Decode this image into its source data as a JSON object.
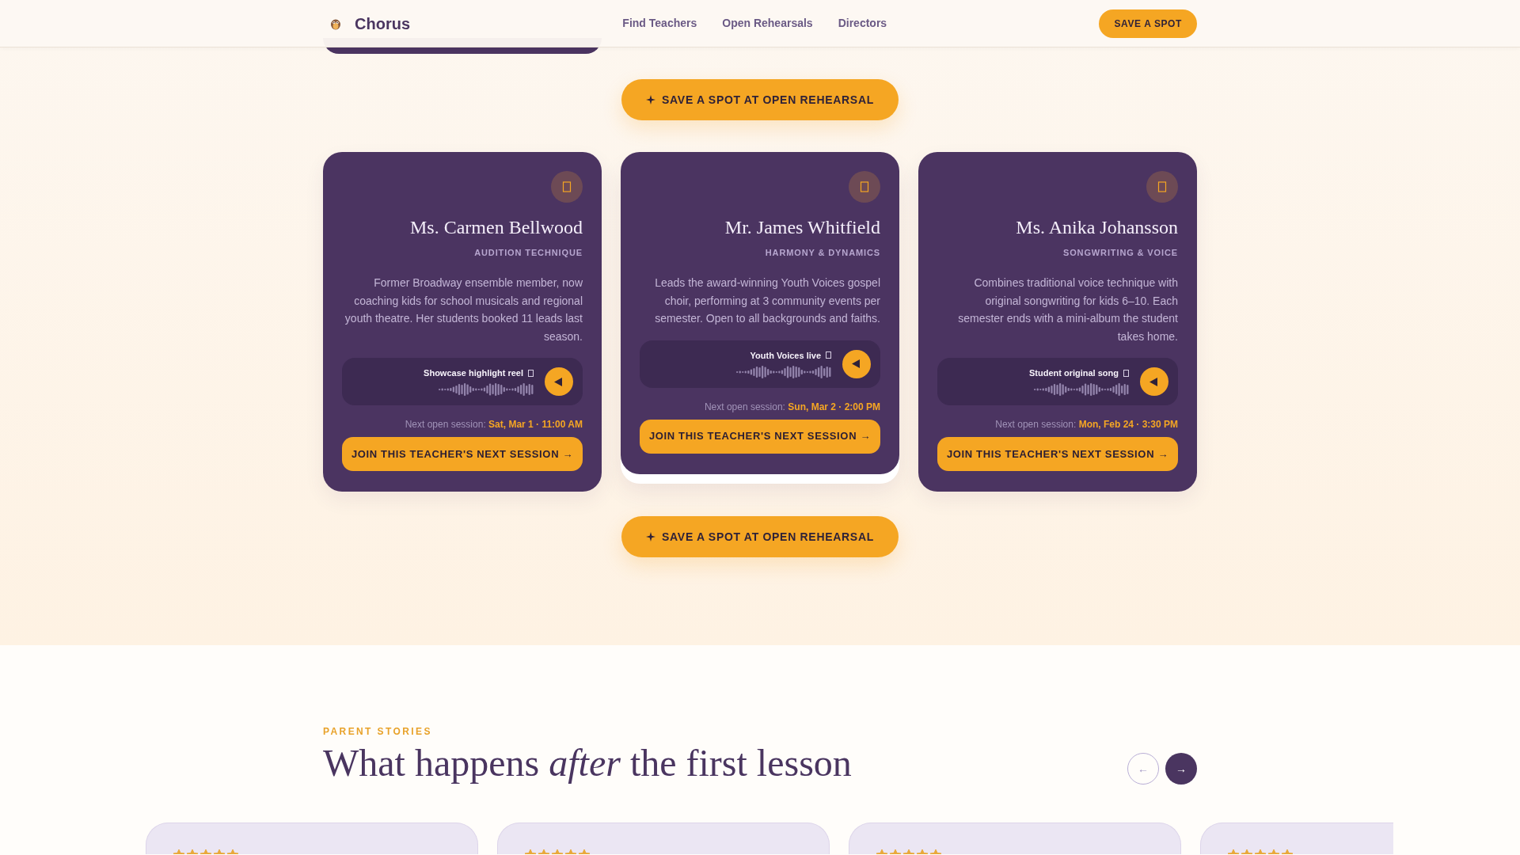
{
  "header": {
    "brand": "Chorus",
    "nav": [
      {
        "label": "Find Teachers"
      },
      {
        "label": "Open Rehearsals"
      },
      {
        "label": "Directors"
      }
    ],
    "cta": "SAVE A SPOT"
  },
  "rehearsal_cta_top": "SAVE A SPOT AT OPEN REHEARSAL",
  "teachers": [
    {
      "name": "Ms. Carmen Bellwood",
      "specialty": "AUDITION TECHNIQUE",
      "bio": "Former Broadway ensemble member, now coaching kids for school musicals and regional youth theatre. Her students booked 11 leads last season.",
      "clip": "Showcase highlight reel",
      "session": "Next open session: **Sat, Mar 1 · 11:00 AM**",
      "join": "JOIN THIS TEACHER'S NEXT SESSION →",
      "raised": false
    },
    {
      "name": "Mr. James Whitfield",
      "specialty": "HARMONY & DYNAMICS",
      "bio": "Leads the award-winning Youth Voices gospel choir, performing at 3 community events per semester. Open to all backgrounds and faiths.",
      "clip": "Youth Voices live",
      "session": "Next open session: **Sun, Mar 2 · 2:00 PM**",
      "join": "JOIN THIS TEACHER'S NEXT SESSION →",
      "raised": true
    },
    {
      "name": "Ms. Anika Johansson",
      "specialty": "SONGWRITING & VOICE",
      "bio": "Combines traditional voice technique with original songwriting for kids 6–10. Each semester ends with a mini-album the student takes home.",
      "clip": "Student original song",
      "session": "Next open session: **Mon, Feb 24 · 3:30 PM**",
      "join": "JOIN THIS TEACHER'S NEXT SESSION →",
      "raised": false
    }
  ],
  "rehearsal_cta_bottom": "SAVE A SPOT AT OPEN REHEARSAL",
  "stories": {
    "eyebrow": "PARENT STORIES",
    "heading": "What happens *after* the first lesson",
    "prev": "←",
    "next": "→",
    "cards": [
      {
        "stars": 5
      },
      {
        "stars": 5
      },
      {
        "stars": 5
      },
      {
        "stars": 5
      }
    ]
  }
}
